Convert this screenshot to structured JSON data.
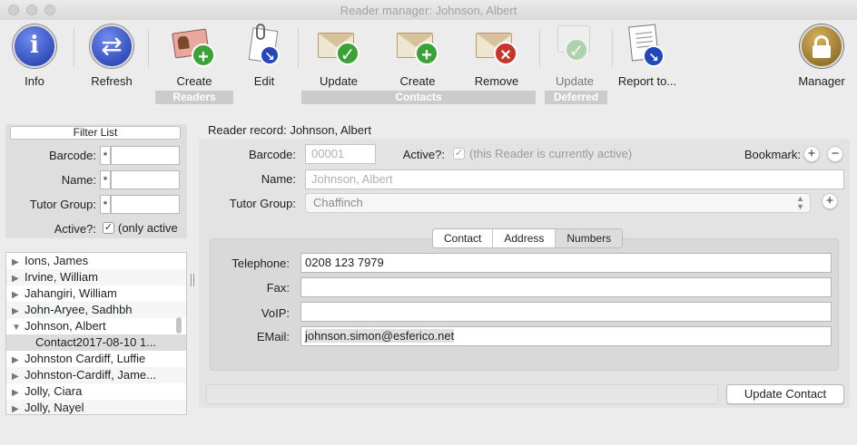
{
  "window": {
    "title": "Reader manager: Johnson, Albert"
  },
  "toolbar": {
    "info": {
      "label": "Info",
      "icon": "info-icon"
    },
    "refresh": {
      "label": "Refresh",
      "icon": "refresh-icon"
    },
    "create_reader": {
      "label": "Create",
      "icon": "create-reader-icon"
    },
    "edit": {
      "label": "Edit",
      "icon": "edit-icon"
    },
    "update_contact": {
      "label": "Update",
      "icon": "update-contact-icon"
    },
    "create_contact": {
      "label": "Create",
      "icon": "create-contact-icon"
    },
    "remove_contact": {
      "label": "Remove",
      "icon": "remove-contact-icon"
    },
    "update_deferred": {
      "label": "Update",
      "icon": "update-deferred-icon"
    },
    "report": {
      "label": "Report to...",
      "icon": "report-icon"
    },
    "manager": {
      "label": "Manager",
      "icon": "unlock-icon"
    },
    "groups": {
      "readers": "Readers",
      "contacts": "Contacts",
      "deferred": "Deferred"
    }
  },
  "filter": {
    "button_label": "Filter List",
    "barcode_label": "Barcode:",
    "name_label": "Name:",
    "tutor_group_label": "Tutor Group:",
    "active_label": "Active?:",
    "active_text": "(only active",
    "wildcard": "*"
  },
  "reader_list": [
    {
      "label": "Ions,  James",
      "expanded": false
    },
    {
      "label": "Irvine,  William",
      "expanded": false
    },
    {
      "label": "Jahangiri,  William",
      "expanded": false
    },
    {
      "label": "John-Aryee,  Sadhbh",
      "expanded": false
    },
    {
      "label": "Johnson, Albert",
      "expanded": true
    },
    {
      "label": "Contact2017-08-10 1...",
      "child": true
    },
    {
      "label": "Johnston Cardiff,  Luffie",
      "expanded": false
    },
    {
      "label": "Johnston-Cardiff,  Jame...",
      "expanded": false
    },
    {
      "label": "Jolly,  Ciara",
      "expanded": false
    },
    {
      "label": "Jolly,  Nayel",
      "expanded": false
    }
  ],
  "record": {
    "title": "Reader record: Johnson, Albert",
    "barcode_label": "Barcode:",
    "barcode_value": "00001",
    "active_label": "Active?:",
    "active_text": "(this Reader is currently active)",
    "bookmark_label": "Bookmark:",
    "name_label": "Name:",
    "name_value": "Johnson, Albert",
    "tutor_group_label": "Tutor Group:",
    "tutor_group_value": "Chaffinch"
  },
  "contact": {
    "tabs": [
      "Contact",
      "Address",
      "Numbers"
    ],
    "active_tab": "Numbers",
    "telephone_label": "Telephone:",
    "telephone_value": "0208 123 7979",
    "fax_label": "Fax:",
    "fax_value": "",
    "voip_label": "VoIP:",
    "voip_value": "",
    "email_label": "EMail:",
    "email_value": "johnson.simon@esferico.net"
  },
  "actions": {
    "update_contact": "Update Contact"
  },
  "colors": {
    "info_blue": "#2346b8",
    "green_badge": "#3aa335",
    "red_badge": "#c8342c",
    "manager_gold": "#a07a2b"
  }
}
